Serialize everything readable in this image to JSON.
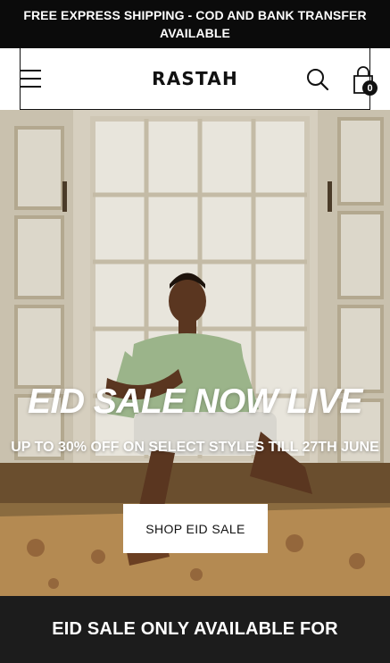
{
  "announcement": {
    "text": "FREE EXPRESS SHIPPING - COD AND BANK TRANSFER AVAILABLE"
  },
  "header": {
    "logo": "RASTAH",
    "menu_icon": "hamburger-menu-icon",
    "search_icon": "search-icon",
    "cart_icon": "shopping-bag-icon",
    "cart_count": "0"
  },
  "hero": {
    "title": "EID SALE NOW LIVE",
    "subtitle": "UP TO 30% OFF ON SELECT STYLES TILL 27TH JUNE",
    "button_label": "SHOP EID SALE"
  },
  "bottom_banner": {
    "text": "EID SALE ONLY AVAILABLE FOR"
  },
  "colors": {
    "announcement_bg": "#0b0b0b",
    "banner_bg": "#1c1c1c",
    "text_light": "#ffffff"
  }
}
